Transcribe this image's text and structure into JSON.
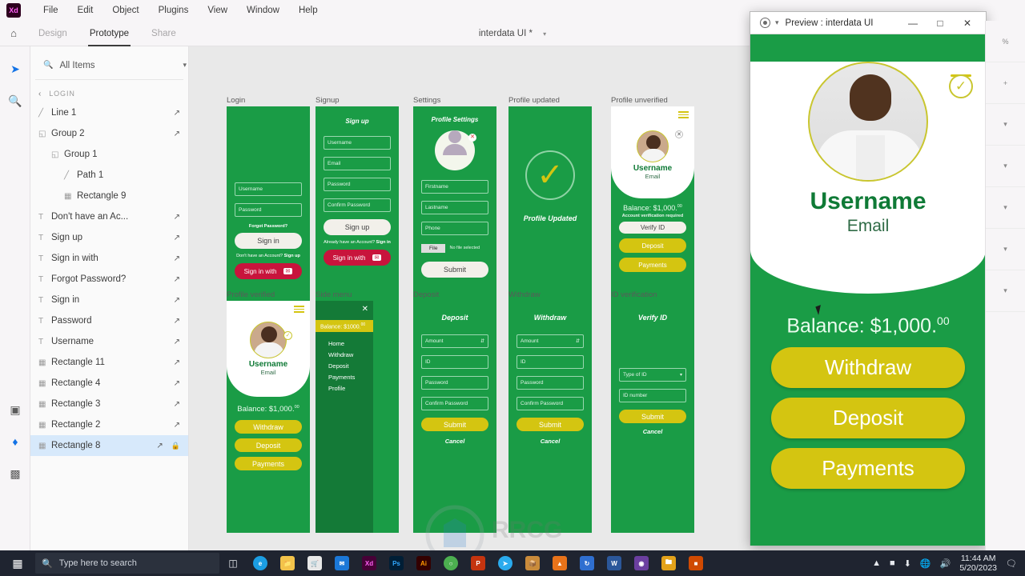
{
  "app": {
    "name": "Adobe XD",
    "logo_text": "Xd",
    "document_title": "interdata UI *",
    "menu": [
      "File",
      "Edit",
      "Object",
      "Plugins",
      "View",
      "Window",
      "Help"
    ],
    "mode_tabs": [
      {
        "label": "Design",
        "active": false
      },
      {
        "label": "Prototype",
        "active": true
      },
      {
        "label": "Share",
        "active": false
      }
    ],
    "home_icon": "home-icon"
  },
  "rail": {
    "icons": [
      "select-tool-icon",
      "zoom-tool-icon",
      "components-icon",
      "layers-icon",
      "plugins-icon"
    ]
  },
  "layers_panel": {
    "search_value": "All Items",
    "search_placeholder": "All Items",
    "group_label": "LOGIN",
    "items": [
      {
        "name": "Line 1",
        "type": "path",
        "indent": 0,
        "link": true,
        "locked": false,
        "selected": false
      },
      {
        "name": "Group 2",
        "type": "group",
        "indent": 0,
        "link": true,
        "locked": false,
        "selected": false
      },
      {
        "name": "Group 1",
        "type": "group",
        "indent": 1,
        "link": false,
        "locked": false,
        "selected": false
      },
      {
        "name": "Path 1",
        "type": "path",
        "indent": 2,
        "link": false,
        "locked": false,
        "selected": false
      },
      {
        "name": "Rectangle 9",
        "type": "rect",
        "indent": 2,
        "link": false,
        "locked": false,
        "selected": false
      },
      {
        "name": "Don't have an Ac...",
        "type": "text",
        "indent": 0,
        "link": true,
        "locked": false,
        "selected": false
      },
      {
        "name": "Sign up",
        "type": "text",
        "indent": 0,
        "link": true,
        "locked": false,
        "selected": false
      },
      {
        "name": "Sign in with",
        "type": "text",
        "indent": 0,
        "link": true,
        "locked": false,
        "selected": false
      },
      {
        "name": "Forgot Password?",
        "type": "text",
        "indent": 0,
        "link": true,
        "locked": false,
        "selected": false
      },
      {
        "name": "Sign in",
        "type": "text",
        "indent": 0,
        "link": true,
        "locked": false,
        "selected": false
      },
      {
        "name": "Password",
        "type": "text",
        "indent": 0,
        "link": true,
        "locked": false,
        "selected": false
      },
      {
        "name": "Username",
        "type": "text",
        "indent": 0,
        "link": true,
        "locked": false,
        "selected": false
      },
      {
        "name": "Rectangle 11",
        "type": "rect",
        "indent": 0,
        "link": true,
        "locked": false,
        "selected": false
      },
      {
        "name": "Rectangle 4",
        "type": "rect",
        "indent": 0,
        "link": true,
        "locked": false,
        "selected": false
      },
      {
        "name": "Rectangle 3",
        "type": "rect",
        "indent": 0,
        "link": true,
        "locked": false,
        "selected": false
      },
      {
        "name": "Rectangle 2",
        "type": "rect",
        "indent": 0,
        "link": true,
        "locked": false,
        "selected": false
      },
      {
        "name": "Rectangle 8",
        "type": "rect",
        "indent": 0,
        "link": true,
        "locked": true,
        "selected": true
      }
    ]
  },
  "canvas": {
    "artboards": {
      "login": {
        "label": "Login",
        "fields": [
          "Username",
          "Password"
        ],
        "forgot": "Forgot Password?",
        "primary_button": "Sign in",
        "footer": "Don't have an Account?",
        "footer_link": "Sign up",
        "social_button": "Sign in with"
      },
      "signup": {
        "label": "Signup",
        "title": "Sign up",
        "fields": [
          "Username",
          "Email",
          "Password",
          "Confirm Password"
        ],
        "primary_button": "Sign up",
        "footer": "Already have an Account?",
        "footer_link": "Sign in",
        "social_button": "Sign in with"
      },
      "settings": {
        "label": "Settings",
        "title": "Profile Settings",
        "fields": [
          "Firstname",
          "Lastname",
          "Phone"
        ],
        "file_button": "File",
        "file_status": "No file selected",
        "primary_button": "Submit"
      },
      "profile_updated": {
        "label": "Profile updated",
        "message": "Profile Updated"
      },
      "profile_unverified": {
        "label": "Profile unverified",
        "username": "Username",
        "email": "Email",
        "balance_label": "Balance: $1,000.",
        "balance_cents": "00",
        "notice": "Account verification required",
        "buttons": [
          "Verify ID",
          "Deposit",
          "Payments"
        ]
      },
      "profile_verified": {
        "label": "Profile verified",
        "username": "Username",
        "email": "Email",
        "balance_label": "Balance: $1,000.",
        "balance_cents": "00",
        "buttons": [
          "Withdraw",
          "Deposit",
          "Payments"
        ]
      },
      "side_menu": {
        "label": "Side menu",
        "balance": "Balance: $1000.",
        "balance_cents": "00",
        "items": [
          "Home",
          "Withdraw",
          "Deposit",
          "Payments",
          "Profile"
        ]
      },
      "deposit": {
        "label": "Deposit",
        "title": "Deposit",
        "fields": [
          "Amount",
          "ID",
          "Password",
          "Confirm Password"
        ],
        "primary_button": "Submit",
        "cancel": "Cancel"
      },
      "withdraw": {
        "label": "Withdraw",
        "title": "Withdraw",
        "fields": [
          "Amount",
          "ID",
          "Password",
          "Confirm Password"
        ],
        "primary_button": "Submit",
        "cancel": "Cancel"
      },
      "id_verification": {
        "label": "ID verification",
        "title": "Verify ID",
        "select_value": "Type of ID",
        "field": "ID number",
        "primary_button": "Submit",
        "cancel": "Cancel"
      }
    }
  },
  "preview": {
    "title": "Preview : interdata UI",
    "window_buttons": {
      "minimize": "—",
      "maximize": "□",
      "close": "✕"
    },
    "username": "Username",
    "email": "Email",
    "balance_label": "Balance: $1,000.",
    "balance_cents": "00",
    "buttons": [
      "Withdraw",
      "Deposit",
      "Payments"
    ],
    "verified_badge": "✓"
  },
  "taskbar": {
    "search_placeholder": "Type here to search",
    "apps": [
      "task-view-icon",
      "edge-icon",
      "file-explorer-icon",
      "store-icon",
      "mail-icon",
      "xd-icon",
      "photoshop-icon",
      "illustrator-icon",
      "chrome-icon",
      "powerpoint-icon",
      "telegram-icon",
      "package-icon",
      "unknown-icon",
      "vlc-icon",
      "sync-icon",
      "word-icon",
      "app-icon",
      "folder-icon",
      "apps-icon"
    ],
    "clock_time": "11:44 AM",
    "clock_date": "5/20/2023"
  },
  "colors": {
    "green": "#1a9c46",
    "yellow": "#d4c511",
    "dark_green": "#0f7a36",
    "red": "#c8143c",
    "accent_blue": "#1473e6"
  }
}
